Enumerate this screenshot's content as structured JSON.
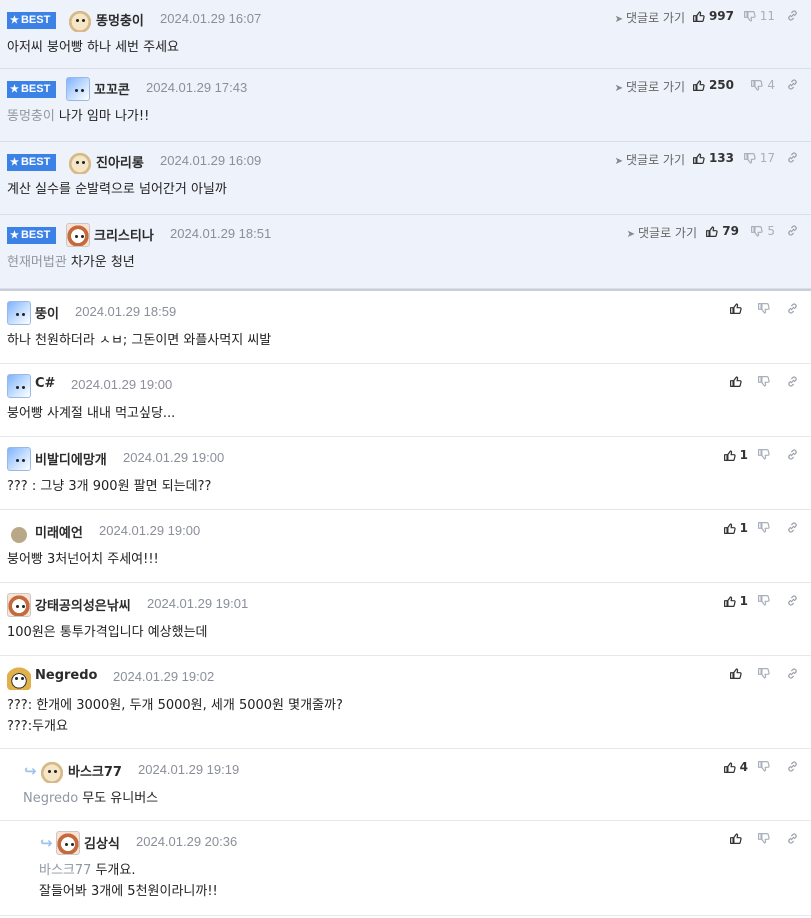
{
  "comments": [
    {
      "best": true,
      "badge": "BEST",
      "nick": "똥멍충이",
      "date": "2024.01.29 16:07",
      "avatar": "puppy",
      "mention": "",
      "lines": [
        "아저씨 붕어빵 하나 세번 주세요"
      ],
      "goto": "댓글로 가기",
      "up": "997",
      "down": "11"
    },
    {
      "best": true,
      "badge": "BEST",
      "nick": "꼬꼬콘",
      "date": "2024.01.29 17:43",
      "avatar": "blue",
      "mention": "똥멍충이",
      "lines": [
        "나가 임마 나가!!"
      ],
      "goto": "댓글로 가기",
      "up": "250",
      "down": "4"
    },
    {
      "best": true,
      "badge": "BEST",
      "nick": "진아리롱",
      "date": "2024.01.29 16:09",
      "avatar": "puppy",
      "mention": "",
      "lines": [
        "계산 실수를 순발력으로 넘어간거 아닐까"
      ],
      "goto": "댓글로 가기",
      "up": "133",
      "down": "17"
    },
    {
      "best": true,
      "badge": "BEST",
      "nick": "크리스티나",
      "date": "2024.01.29 18:51",
      "avatar": "dog",
      "mention": "현재머법관",
      "lines": [
        "차가운 청년"
      ],
      "goto": "댓글로 가기",
      "up": "79",
      "down": "5"
    },
    {
      "best": false,
      "nick": "뚱이",
      "date": "2024.01.29 18:59",
      "avatar": "blue",
      "mention": "",
      "lines": [
        "하나 천원하더라 ㅅㅂ; 그돈이면 와플사먹지 씨발"
      ],
      "up": "",
      "down": ""
    },
    {
      "best": false,
      "nick": "C#",
      "date": "2024.01.29 19:00",
      "avatar": "blue",
      "mention": "",
      "lines": [
        "붕어빵 사계절 내내 먹고싶당..."
      ],
      "up": "",
      "down": ""
    },
    {
      "best": false,
      "nick": "비발디에망개",
      "date": "2024.01.29 19:00",
      "avatar": "blue",
      "mention": "",
      "lines": [
        "??? : 그냥 3개 900원 팔면 되는데??"
      ],
      "up": "1",
      "down": ""
    },
    {
      "best": false,
      "nick": "미래예언",
      "date": "2024.01.29 19:00",
      "avatar": "dot",
      "mention": "",
      "lines": [
        "붕어빵 3처넌어치 주세여!!!"
      ],
      "up": "1",
      "down": ""
    },
    {
      "best": false,
      "nick": "강태공의성은낚씨",
      "date": "2024.01.29 19:01",
      "avatar": "dog",
      "mention": "",
      "lines": [
        "100원은 통투가격입니다 예상했는데"
      ],
      "up": "1",
      "down": ""
    },
    {
      "best": false,
      "nick": "Negredo",
      "date": "2024.01.29 19:02",
      "avatar": "fox",
      "mention": "",
      "lines": [
        "???: 한개에 3000원, 두개 5000원, 세개 5000원 몇개줄까?",
        "???:두개요"
      ],
      "up": "",
      "down": ""
    },
    {
      "best": false,
      "nick": "바스크77",
      "date": "2024.01.29 19:19",
      "avatar": "puppy",
      "mention": "Negredo",
      "lines": [
        "무도 유니버스"
      ],
      "up": "4",
      "down": ""
    },
    {
      "best": false,
      "nick": "김상식",
      "date": "2024.01.29 20:36",
      "avatar": "dog",
      "mention": "바스크77",
      "lines": [
        "두개요.",
        "잘들어봐 3개에 5천원이라니까!!"
      ],
      "up": "",
      "down": ""
    }
  ],
  "icons": {
    "thumb_up": "thumb-up-icon",
    "thumb_down": "thumb-down-icon",
    "link": "link-icon",
    "goto": "send-arrow-icon",
    "star": "star-icon",
    "reply": "reply-arrow-icon"
  },
  "colors": {
    "best_badge": "#3c82e6",
    "best_bg": "#eef2fa",
    "mention": "#9097a3",
    "reply_arrow": "#9fc3ec"
  }
}
